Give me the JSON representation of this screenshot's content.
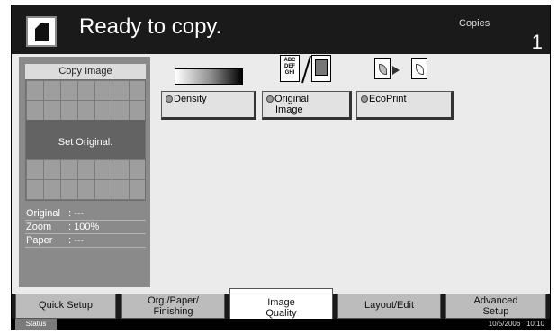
{
  "header": {
    "title": "Ready to copy.",
    "copies_label": "Copies",
    "copies_value": "1",
    "icon": "document-icon"
  },
  "preview": {
    "title": "Copy Image",
    "message": "Set Original.",
    "original_label": "Original",
    "original_value": ": ---",
    "zoom_label": "Zoom",
    "zoom_value": ": 100%",
    "paper_label": "Paper",
    "paper_value": ": ---"
  },
  "functions": {
    "density": {
      "label": "Density",
      "icon": "density-gradient-icon"
    },
    "original_image": {
      "label_line1": "Original",
      "label_line2": "Image",
      "icons": [
        "text-original-icon",
        "photo-original-icon"
      ],
      "abc_text": "ABC DEF GHI"
    },
    "ecoprint": {
      "label": "EcoPrint",
      "icon": "ecoprint-leaf-icon"
    }
  },
  "tabs": [
    {
      "label": "Quick Setup",
      "active": false
    },
    {
      "label_line1": "Org./Paper/",
      "label_line2": "Finishing",
      "active": false
    },
    {
      "label_line1": "Image",
      "label_line2": "Quality",
      "active": true
    },
    {
      "label": "Layout/Edit",
      "active": false
    },
    {
      "label_line1": "Advanced",
      "label_line2": "Setup",
      "active": false
    }
  ],
  "status_bar": {
    "status_label": "Status",
    "date": "10/5/2006",
    "time": "10:10"
  },
  "colors": {
    "header_bg": "#1a1a1a",
    "body_bg": "#ebebeb",
    "panel_bg": "#8a8a8a",
    "active_tab_bg": "#ffffff",
    "inactive_tab_bg": "#bcbcbc"
  }
}
